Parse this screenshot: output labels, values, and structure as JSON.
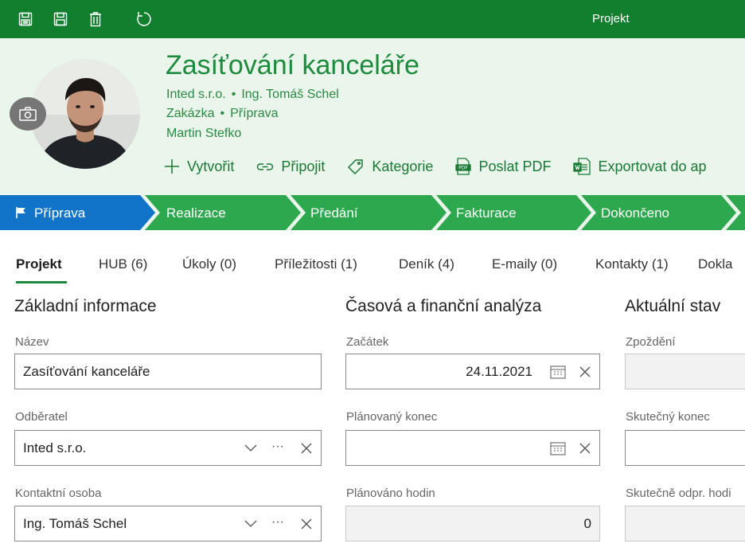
{
  "topbar": {
    "title": "Projekt",
    "icons": [
      "save-close-icon",
      "save-icon",
      "delete-icon",
      "refresh-icon"
    ],
    "color": "#127f2f"
  },
  "header": {
    "title": "Zasíťování kanceláře",
    "line1": {
      "company": "Inted s.r.o.",
      "sep": "•",
      "person": "Ing. Tomáš Schel"
    },
    "line2": {
      "type": "Zakázka",
      "sep": "•",
      "stage": "Příprava"
    },
    "line3": "Martin Stefko",
    "background": "#eaf6ec"
  },
  "actions": [
    {
      "label": "Vytvořit",
      "icon": "plus-icon"
    },
    {
      "label": "Připojit",
      "icon": "link-icon"
    },
    {
      "label": "Kategorie",
      "icon": "tag-icon"
    },
    {
      "label": "Poslat PDF",
      "icon": "pdf-icon"
    },
    {
      "label": "Exportovat do ap",
      "icon": "word-export-icon"
    }
  ],
  "stages": [
    {
      "label": "Příprava",
      "active": true,
      "color": "#1274c8"
    },
    {
      "label": "Realizace",
      "color": "#2ea84e"
    },
    {
      "label": "Předání",
      "color": "#2ea84e"
    },
    {
      "label": "Fakturace",
      "color": "#2ea84e"
    },
    {
      "label": "Dokončeno",
      "color": "#2ea84e"
    }
  ],
  "tabs": [
    {
      "label": "Projekt",
      "active": true
    },
    {
      "label": "HUB (6)"
    },
    {
      "label": "Úkoly (0)"
    },
    {
      "label": "Příležitosti (1)"
    },
    {
      "label": "Deník (4)"
    },
    {
      "label": "E-maily (0)"
    },
    {
      "label": "Kontakty (1)"
    },
    {
      "label": "Dokla"
    }
  ],
  "sections": {
    "basic": {
      "title": "Základní informace",
      "name_label": "Název",
      "name_value": "Zasíťování kanceláře",
      "customer_label": "Odběratel",
      "customer_value": "Inted s.r.o.",
      "contact_label": "Kontaktní osoba",
      "contact_value": "Ing. Tomáš Schel",
      "more_glyph": "···"
    },
    "time": {
      "title": "Časová a finanční analýza",
      "start_label": "Začátek",
      "start_value": "24.11.2021",
      "planned_end_label": "Plánovaný konec",
      "planned_end_value": "",
      "planned_hours_label": "Plánováno hodin",
      "planned_hours_value": "0"
    },
    "status": {
      "title": "Aktuální stav",
      "delay_label": "Zpoždění",
      "actual_end_label": "Skutečný konec",
      "actual_hours_label": "Skutečně odpr. hodi"
    }
  }
}
